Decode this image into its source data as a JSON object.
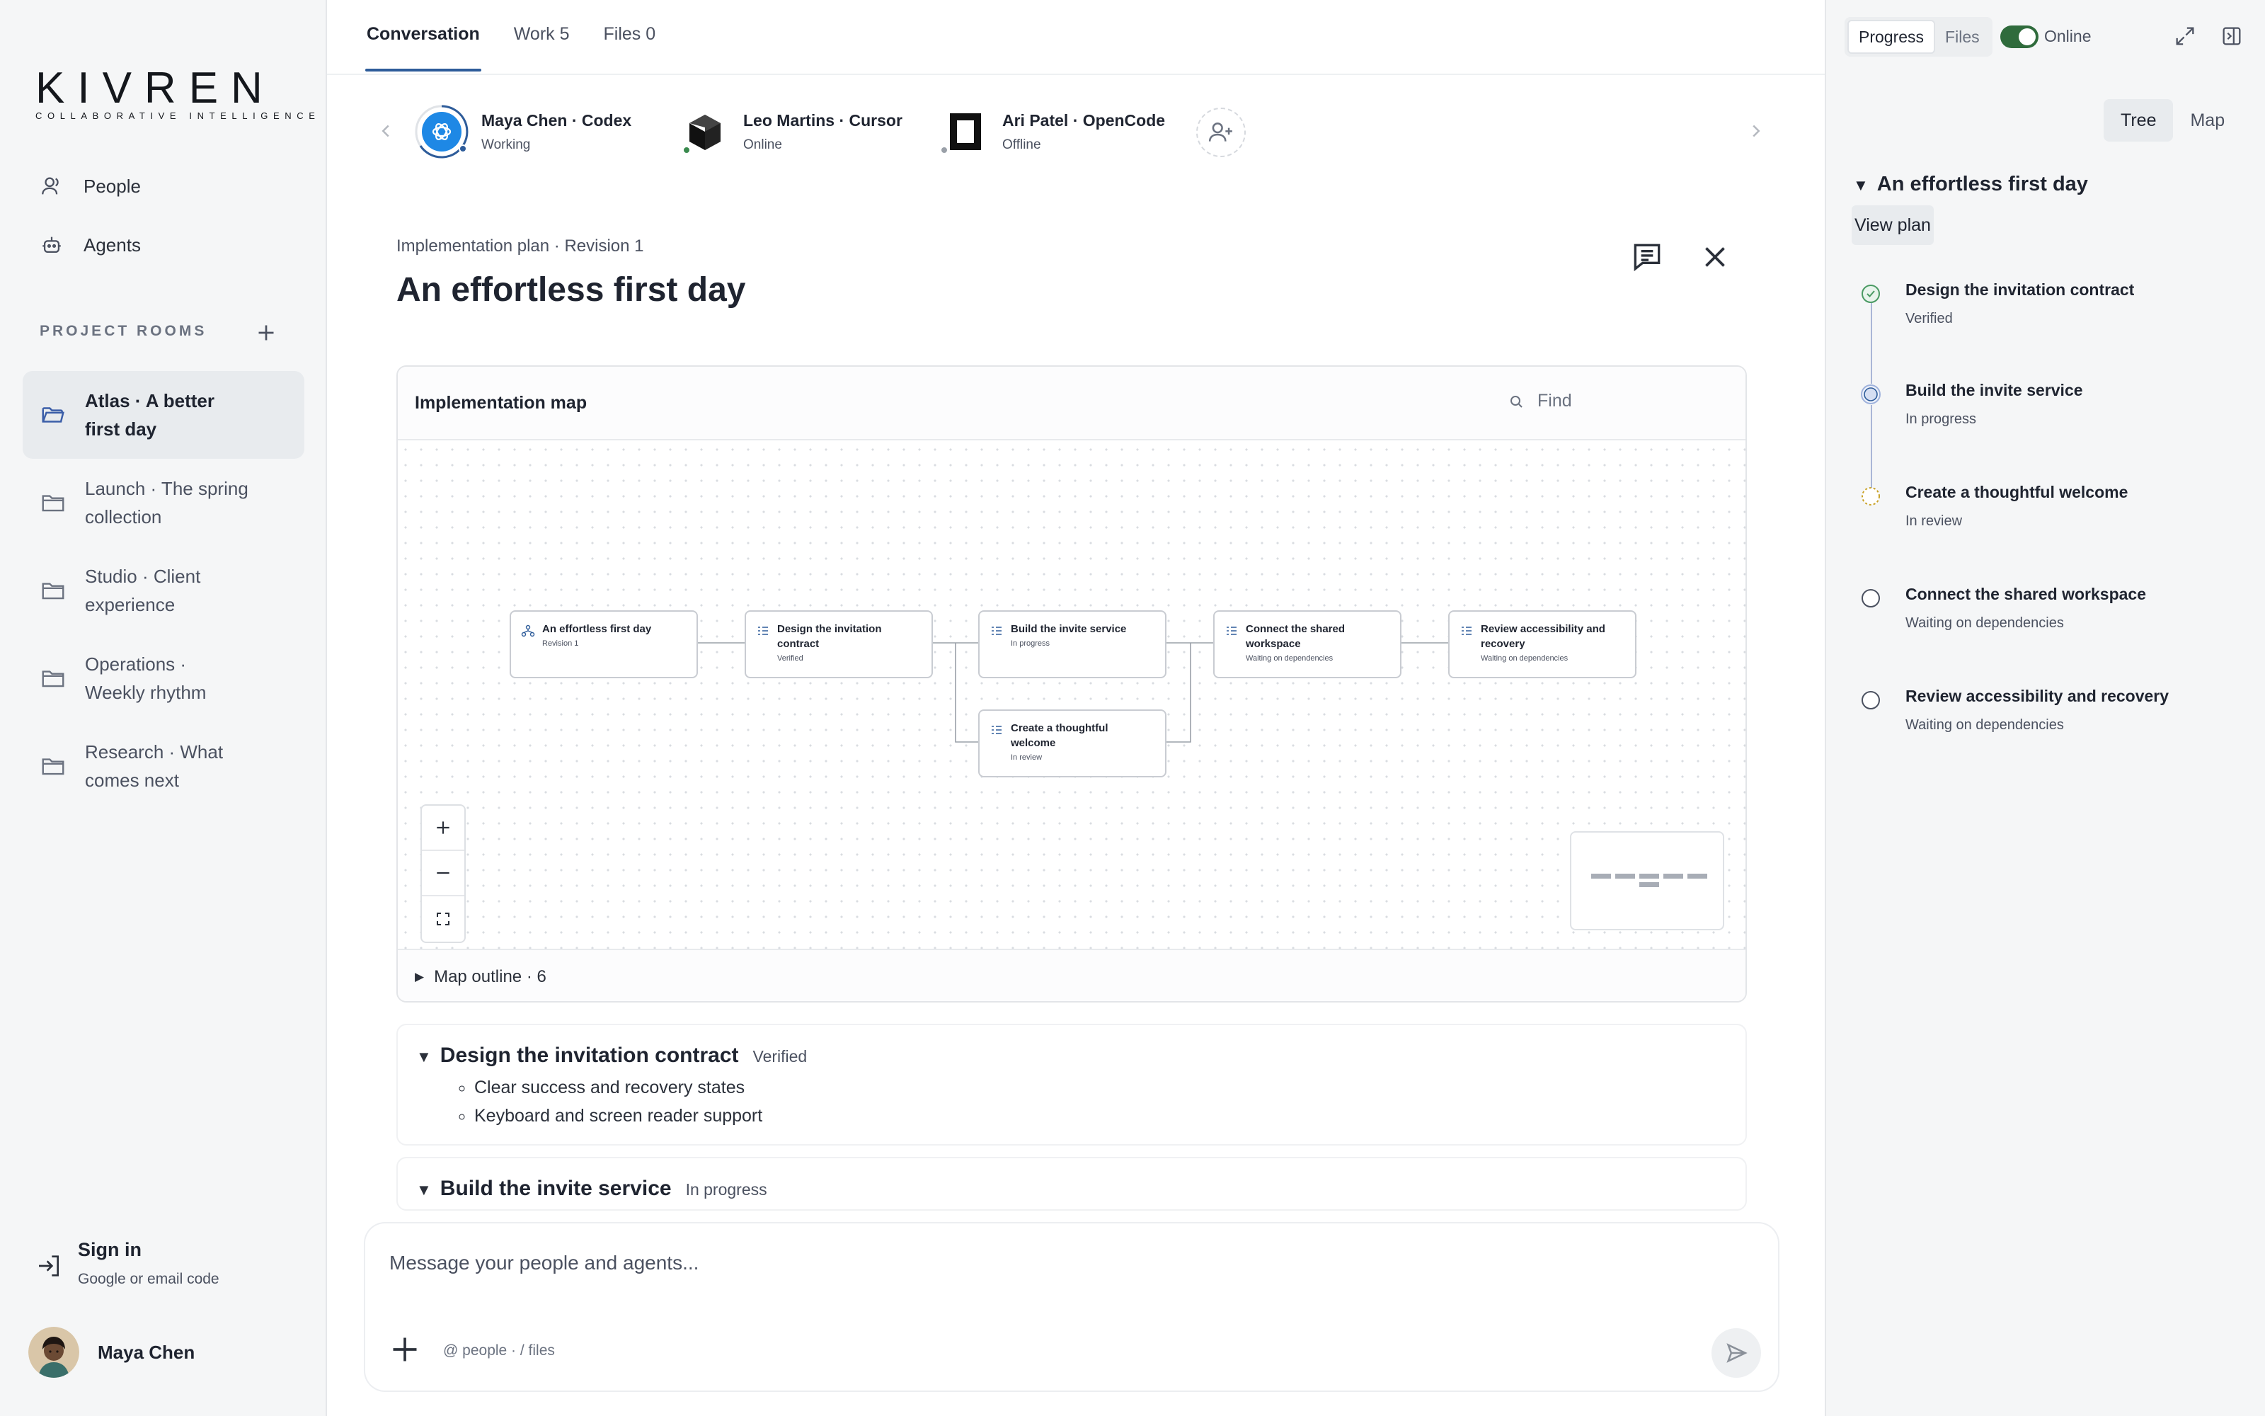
{
  "brand": {
    "name": "KIVREN",
    "tagline": "COLLABORATIVE INTELLIGENCE"
  },
  "nav": [
    {
      "label": "People",
      "icon": "user-icon"
    },
    {
      "label": "Agents",
      "icon": "robot-icon"
    }
  ],
  "rooms_section": {
    "title": "PROJECT ROOMS"
  },
  "rooms": [
    {
      "line1": "Atlas · A better",
      "line2": "first day",
      "active": true
    },
    {
      "line1": "Launch · The spring",
      "line2": "collection"
    },
    {
      "line1": "Studio · Client",
      "line2": "experience"
    },
    {
      "line1": "Operations ·",
      "line2": "Weekly rhythm"
    },
    {
      "line1": "Research · What",
      "line2": "comes next"
    }
  ],
  "signin": {
    "title": "Sign in",
    "subtitle": "Google or email code"
  },
  "user": {
    "name": "Maya Chen"
  },
  "tabs": [
    {
      "label": "Conversation"
    },
    {
      "label": "Work 5"
    },
    {
      "label": "Files 0"
    }
  ],
  "agents": [
    {
      "name": "Maya Chen · Codex",
      "status": "Working"
    },
    {
      "name": "Leo Martins · Cursor",
      "status": "Online"
    },
    {
      "name": "Ari Patel · OpenCode",
      "status": "Offline"
    }
  ],
  "plan": {
    "crumb": "Implementation plan · Revision 1",
    "title": "An effortless first day"
  },
  "map": {
    "title": "Implementation map",
    "find_placeholder": "Find",
    "outline": "Map outline · 6",
    "nodes": [
      {
        "title": "An effortless first day",
        "status": "Revision 1"
      },
      {
        "title": "Design the invitation",
        "title2": "contract",
        "status": "Verified"
      },
      {
        "title": "Build the invite service",
        "status": "In progress"
      },
      {
        "title": "Connect the shared",
        "title2": "workspace",
        "status": "Waiting on dependencies"
      },
      {
        "title": "Review accessibility and",
        "title2": "recovery",
        "status": "Waiting on dependencies"
      },
      {
        "title": "Create a thoughtful welcome",
        "status": "In review"
      }
    ]
  },
  "sections": [
    {
      "title": "Design the invitation contract",
      "status": "Verified",
      "items": [
        "Clear success and recovery states",
        "Keyboard and screen reader support"
      ]
    },
    {
      "title": "Build the invite service",
      "status": "In progress"
    }
  ],
  "composer": {
    "placeholder": "Message your people and agents...",
    "hint": "@ people · / files"
  },
  "right": {
    "seg": [
      "Progress",
      "Files"
    ],
    "online": "Online",
    "views": [
      "Tree",
      "Map"
    ],
    "title": "An effortless first day",
    "view_plan": "View plan",
    "steps": [
      {
        "title": "Design the invitation contract",
        "status": "Verified"
      },
      {
        "title": "Build the invite service",
        "status": "In progress"
      },
      {
        "title": "Create a thoughtful welcome",
        "status": "In review"
      },
      {
        "title": "Connect the shared workspace",
        "status": "Waiting on dependencies"
      },
      {
        "title": "Review accessibility and recovery",
        "status": "Waiting on dependencies"
      }
    ]
  },
  "colors": {
    "accent": "#2e5c9a",
    "online": "#2f6b3c",
    "verified": "#4a9a63",
    "review": "#c9a227"
  }
}
